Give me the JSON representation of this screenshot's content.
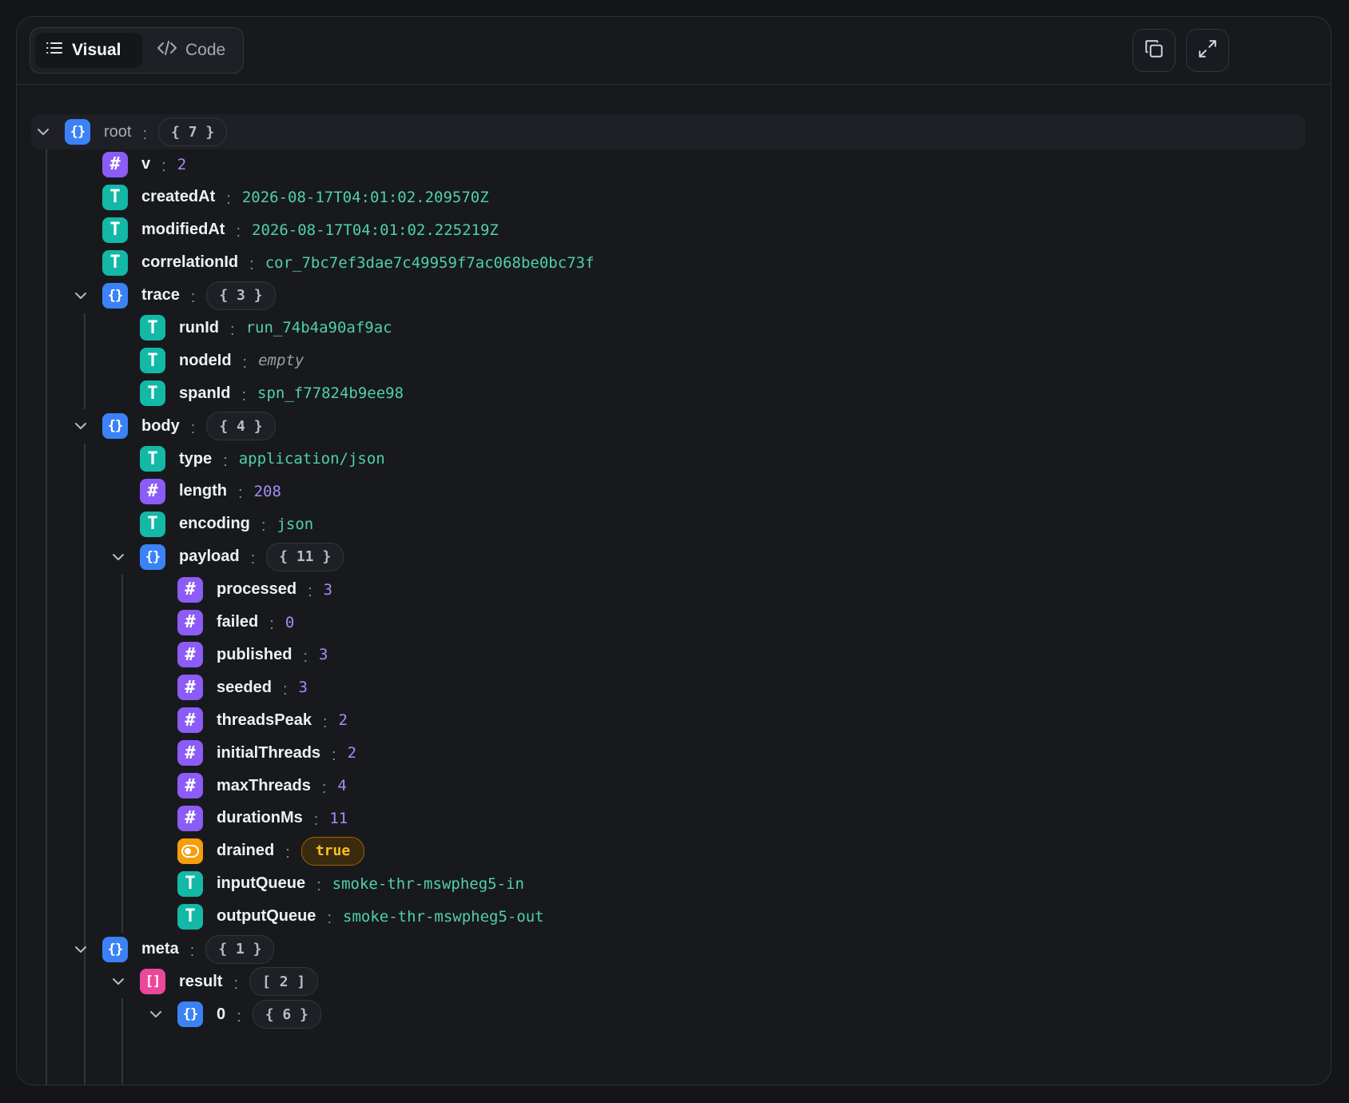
{
  "toolbar": {
    "tabs": [
      {
        "label": "Visual",
        "icon": "list-icon",
        "active": true
      },
      {
        "label": "Code",
        "icon": "code-icon",
        "active": false
      }
    ],
    "actions": [
      "copy-icon",
      "expand-icon"
    ]
  },
  "colors": {
    "object": "#3b82f6",
    "array": "#ec4899",
    "number": "#8b5cf6",
    "string": "#14b8a6",
    "boolean": "#f59e0b"
  },
  "tree": [
    {
      "name": "root",
      "kind": "object",
      "count": "{ 7 }",
      "depth": 0,
      "root": true
    },
    {
      "name": "v",
      "kind": "number",
      "value": "2",
      "depth": 1
    },
    {
      "name": "createdAt",
      "kind": "string",
      "value": "2026-08-17T04:01:02.209570Z",
      "depth": 1
    },
    {
      "name": "modifiedAt",
      "kind": "string",
      "value": "2026-08-17T04:01:02.225219Z",
      "depth": 1
    },
    {
      "name": "correlationId",
      "kind": "string",
      "value": "cor_7bc7ef3dae7c49959f7ac068be0bc73f",
      "depth": 1
    },
    {
      "name": "trace",
      "kind": "object",
      "count": "{ 3 }",
      "depth": 1
    },
    {
      "name": "runId",
      "kind": "string",
      "value": "run_74b4a90af9ac",
      "depth": 2
    },
    {
      "name": "nodeId",
      "kind": "string",
      "value": "empty",
      "empty": true,
      "depth": 2
    },
    {
      "name": "spanId",
      "kind": "string",
      "value": "spn_f77824b9ee98",
      "depth": 2
    },
    {
      "name": "body",
      "kind": "object",
      "count": "{ 4 }",
      "depth": 1
    },
    {
      "name": "type",
      "kind": "string",
      "value": "application/json",
      "depth": 2
    },
    {
      "name": "length",
      "kind": "number",
      "value": "208",
      "depth": 2
    },
    {
      "name": "encoding",
      "kind": "string",
      "value": "json",
      "depth": 2
    },
    {
      "name": "payload",
      "kind": "object",
      "count": "{ 11 }",
      "depth": 2
    },
    {
      "name": "processed",
      "kind": "number",
      "value": "3",
      "depth": 3
    },
    {
      "name": "failed",
      "kind": "number",
      "value": "0",
      "depth": 3
    },
    {
      "name": "published",
      "kind": "number",
      "value": "3",
      "depth": 3
    },
    {
      "name": "seeded",
      "kind": "number",
      "value": "3",
      "depth": 3
    },
    {
      "name": "threadsPeak",
      "kind": "number",
      "value": "2",
      "depth": 3
    },
    {
      "name": "initialThreads",
      "kind": "number",
      "value": "2",
      "depth": 3
    },
    {
      "name": "maxThreads",
      "kind": "number",
      "value": "4",
      "depth": 3
    },
    {
      "name": "durationMs",
      "kind": "number",
      "value": "11",
      "depth": 3
    },
    {
      "name": "drained",
      "kind": "boolean",
      "value": "true",
      "depth": 3
    },
    {
      "name": "inputQueue",
      "kind": "string",
      "value": "smoke-thr-mswpheg5-in",
      "depth": 3
    },
    {
      "name": "outputQueue",
      "kind": "string",
      "value": "smoke-thr-mswpheg5-out",
      "depth": 3
    },
    {
      "name": "meta",
      "kind": "object",
      "count": "{ 1 }",
      "depth": 1
    },
    {
      "name": "result",
      "kind": "array",
      "count": "[ 2 ]",
      "depth": 2
    },
    {
      "name": "0",
      "kind": "object",
      "count": "{ 6 }",
      "depth": 3
    }
  ]
}
